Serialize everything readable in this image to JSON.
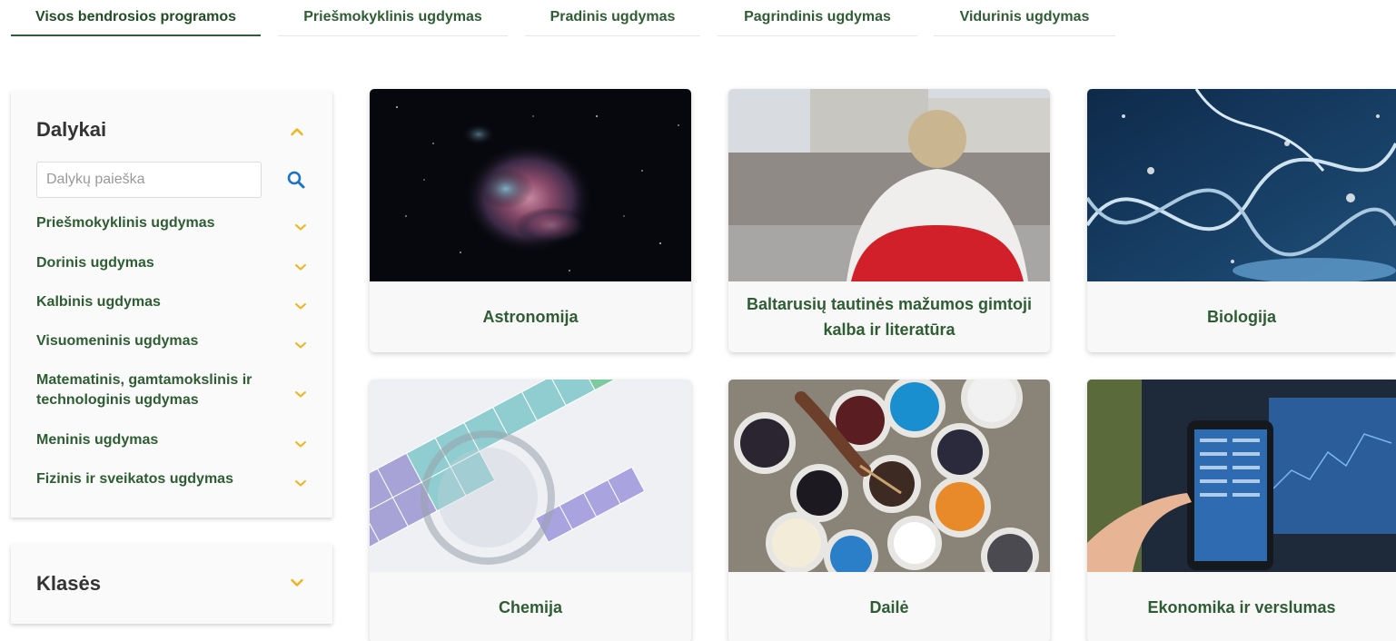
{
  "tabs": [
    {
      "label": "Visos bendrosios programos",
      "active": true
    },
    {
      "label": "Priešmokyklinis ugdymas",
      "active": false
    },
    {
      "label": "Pradinis ugdymas",
      "active": false
    },
    {
      "label": "Pagrindinis ugdymas",
      "active": false
    },
    {
      "label": "Vidurinis ugdymas",
      "active": false
    }
  ],
  "sidebar": {
    "subjects": {
      "title": "Dalykai",
      "search_placeholder": "Dalykų paieška",
      "items": [
        {
          "label": "Priešmokyklinis ugdymas"
        },
        {
          "label": "Dorinis ugdymas"
        },
        {
          "label": "Kalbinis ugdymas"
        },
        {
          "label": "Visuomeninis ugdymas"
        },
        {
          "label": "Matematinis, gamtamokslinis ir technologinis ugdymas"
        },
        {
          "label": "Meninis ugdymas"
        },
        {
          "label": "Fizinis ir sveikatos ugdymas"
        }
      ]
    },
    "grades": {
      "title": "Klasės"
    }
  },
  "cards": [
    {
      "label": "Astronomija",
      "image": "nebula-image"
    },
    {
      "label": "Baltarusių tautinės mažumos gimtoji kalba ir literatūra",
      "image": "flag-crowd-image"
    },
    {
      "label": "Biologija",
      "image": "dna-image"
    },
    {
      "label": "Chemija",
      "image": "periodic-table-image"
    },
    {
      "label": "Dailė",
      "image": "paint-cans-image"
    },
    {
      "label": "Ekonomika ir verslumas",
      "image": "trading-tablet-image"
    }
  ],
  "colors": {
    "accent_green": "#2f5d33",
    "chevron_yellow": "#f2b318",
    "search_blue": "#1a73c8"
  }
}
